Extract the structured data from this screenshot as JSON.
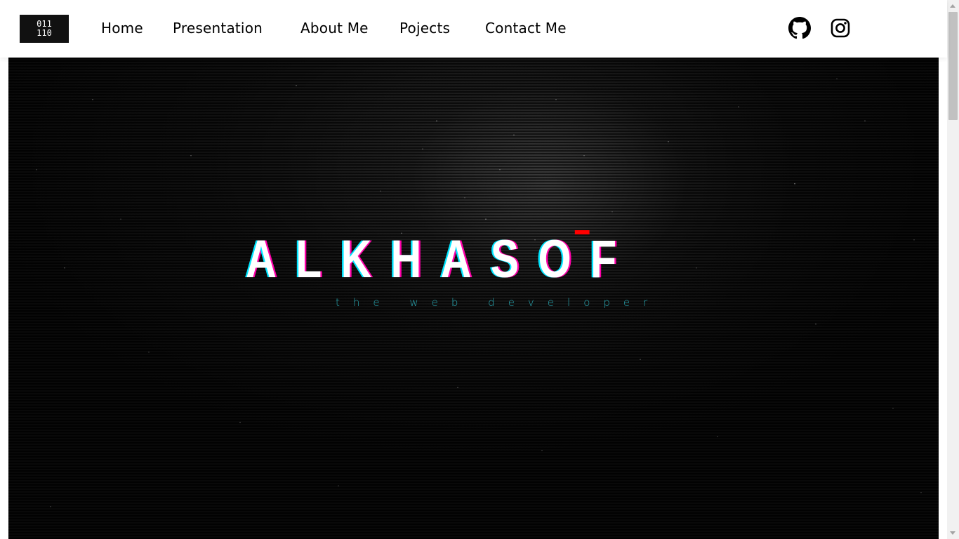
{
  "logo": {
    "line1": "011",
    "line2": "110"
  },
  "nav": {
    "items": [
      {
        "label": "Home"
      },
      {
        "label": "Presentation"
      },
      {
        "label": "About Me"
      },
      {
        "label": "Pojects"
      },
      {
        "label": "Contact Me"
      }
    ]
  },
  "social": {
    "github_icon": "github-icon",
    "instagram_icon": "instagram-icon"
  },
  "hero": {
    "title": "ALKHASOF",
    "subtitle": "the web developer",
    "subtitle_color": "#2aa6b0",
    "glitch_color": "#ff0000"
  }
}
